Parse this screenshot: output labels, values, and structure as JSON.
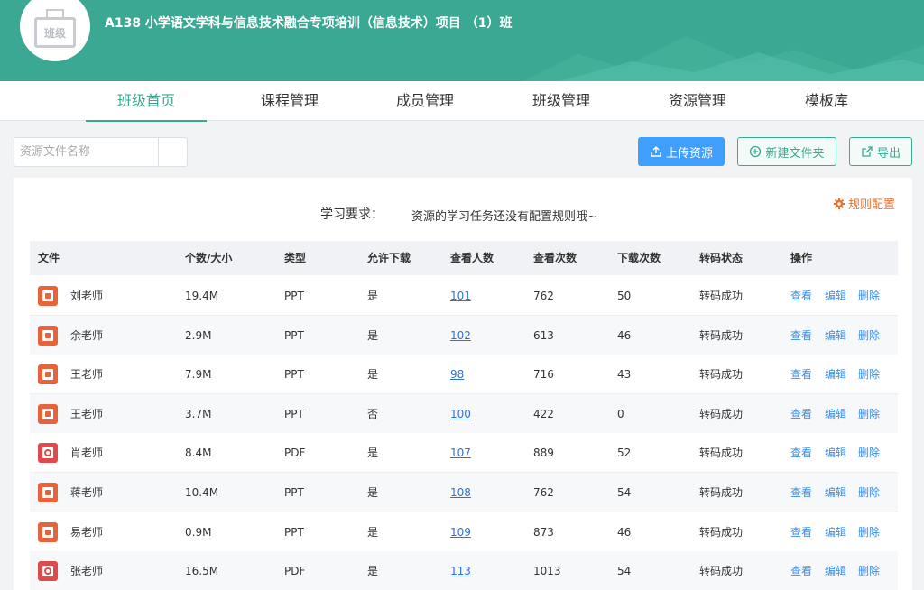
{
  "header": {
    "logo_text": "班级",
    "class_title": "A138 小学语文学科与信息技术融合专项培训（信息技术）项目 （1）班"
  },
  "nav": {
    "tabs": [
      "班级首页",
      "课程管理",
      "成员管理",
      "班级管理",
      "资源管理",
      "模板库"
    ],
    "active_index": 0
  },
  "toolbar": {
    "search_placeholder": "资源文件名称",
    "upload_label": "上传资源",
    "new_folder_label": "新建文件夹",
    "export_label": "导出"
  },
  "requirements": {
    "label": "学习要求：",
    "value": "资源的学习任务还没有配置规则哦~",
    "rules_label": "规则配置"
  },
  "table": {
    "columns": [
      "文件",
      "个数/大小",
      "类型",
      "允许下载",
      "查看人数",
      "查看次数",
      "下载次数",
      "转码状态",
      "操作"
    ],
    "actions": {
      "view": "查看",
      "edit": "编辑",
      "delete": "删除"
    },
    "rows": [
      {
        "icon": "ppt",
        "name": "刘老师",
        "size": "19.4M",
        "type": "PPT",
        "download": "是",
        "viewers": "101",
        "views": "762",
        "downloads": "50",
        "status": "转码成功"
      },
      {
        "icon": "ppt",
        "name": "余老师",
        "size": "2.9M",
        "type": "PPT",
        "download": "是",
        "viewers": "102",
        "views": "613",
        "downloads": "46",
        "status": "转码成功"
      },
      {
        "icon": "ppt",
        "name": "王老师",
        "size": "7.9M",
        "type": "PPT",
        "download": "是",
        "viewers": "98",
        "views": "716",
        "downloads": "43",
        "status": "转码成功"
      },
      {
        "icon": "ppt",
        "name": "王老师",
        "size": "3.7M",
        "type": "PPT",
        "download": "否",
        "viewers": "100",
        "views": "422",
        "downloads": "0",
        "status": "转码成功"
      },
      {
        "icon": "pdf",
        "name": "肖老师",
        "size": "8.4M",
        "type": "PDF",
        "download": "是",
        "viewers": "107",
        "views": "889",
        "downloads": "52",
        "status": "转码成功"
      },
      {
        "icon": "ppt",
        "name": "蒋老师",
        "size": "10.4M",
        "type": "PPT",
        "download": "是",
        "viewers": "108",
        "views": "762",
        "downloads": "54",
        "status": "转码成功"
      },
      {
        "icon": "ppt",
        "name": "易老师",
        "size": "0.9M",
        "type": "PPT",
        "download": "是",
        "viewers": "109",
        "views": "873",
        "downloads": "46",
        "status": "转码成功"
      },
      {
        "icon": "pdf",
        "name": "张老师",
        "size": "16.5M",
        "type": "PDF",
        "download": "是",
        "viewers": "113",
        "views": "1013",
        "downloads": "54",
        "status": "转码成功"
      }
    ]
  },
  "colors": {
    "brand": "#3aa892",
    "primary": "#409eff",
    "link": "#3370cc",
    "rules": "#e6702e"
  }
}
